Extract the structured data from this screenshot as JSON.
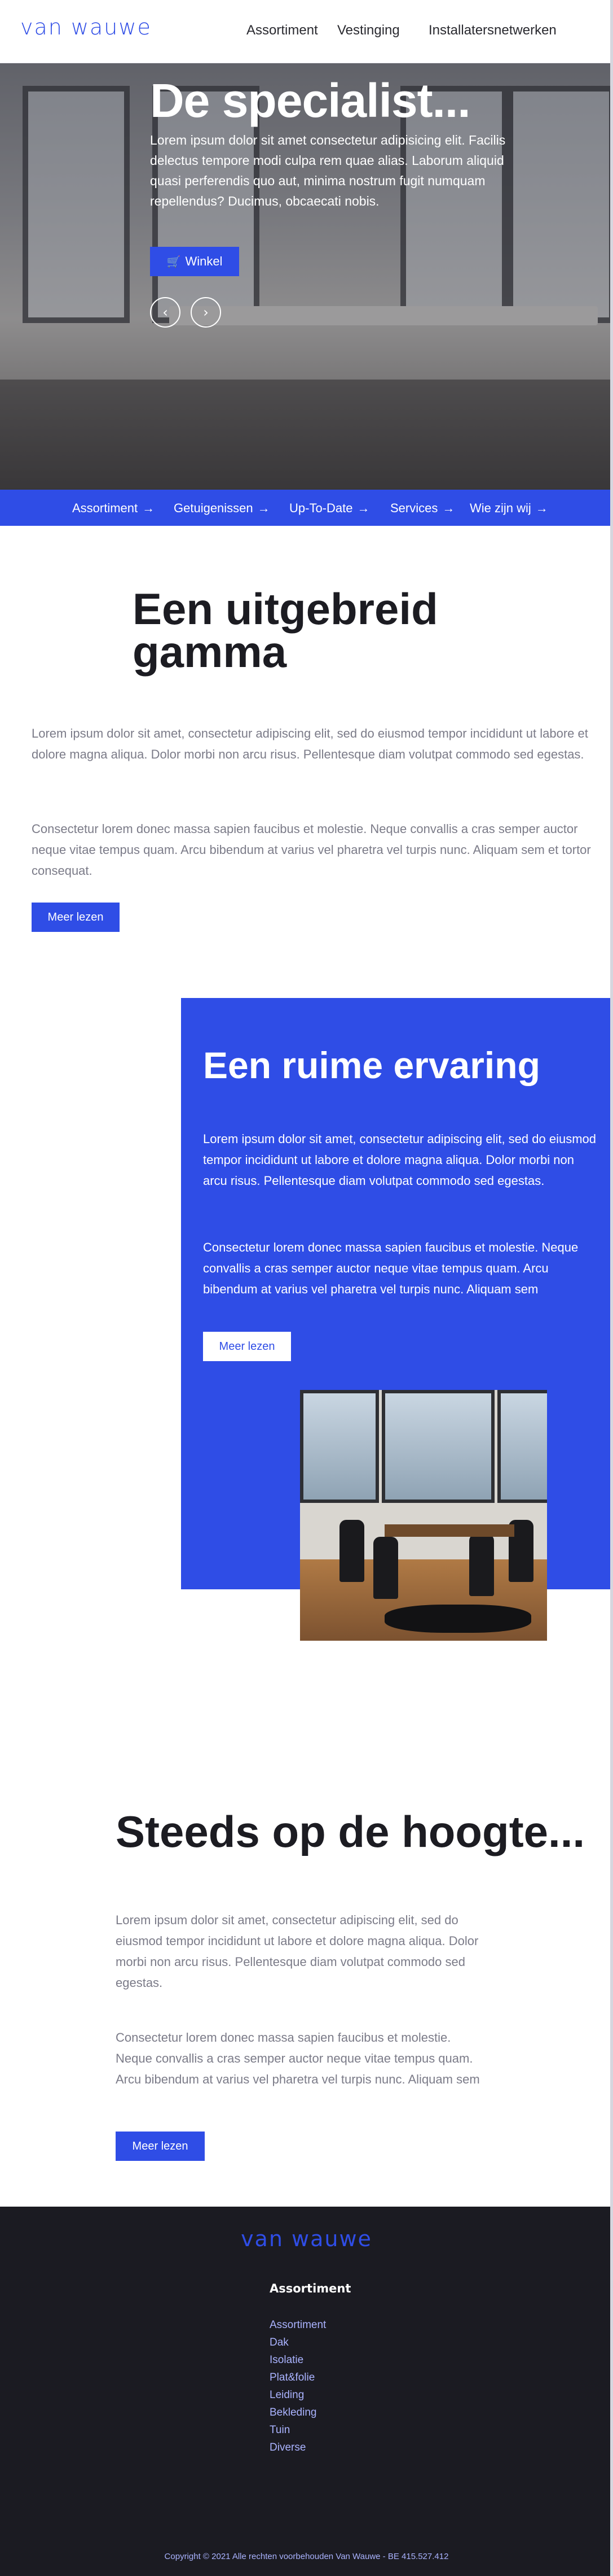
{
  "header": {
    "logo": "van wauwe",
    "nav": [
      "Assortiment",
      "Vestinging",
      "Installatersnetwerken"
    ]
  },
  "hero": {
    "title": "De specialist...",
    "text": "Lorem ipsum dolor sit amet consectetur adipisicing elit. Facilis delectus tempore modi culpa rem quae alias. Laborum aliquid quasi perferendis quo aut, minima nostrum fugit numquam repellendus? Ducimus, obcaecati nobis.",
    "button": "Winkel",
    "prev_icon": "‹",
    "next_icon": "›"
  },
  "linkbar": {
    "items": [
      "Assortiment",
      "Getuigenissen",
      "Up-To-Date",
      "Services",
      "Wie zijn wij"
    ],
    "arrow": "→"
  },
  "section1": {
    "title": "Een uitgebreid gamma",
    "p1": "Lorem ipsum dolor sit amet, consectetur adipiscing elit, sed do eiusmod tempor incididunt ut labore et dolore magna aliqua. Dolor morbi non arcu risus. Pellentesque diam volutpat commodo sed egestas.",
    "p2": "Consectetur lorem donec massa sapien faucibus et molestie. Neque convallis a cras semper auctor neque vitae tempus quam. Arcu bibendum at varius vel pharetra vel turpis nunc. Aliquam sem et tortor consequat.",
    "button": "Meer lezen"
  },
  "section2": {
    "title": "Een ruime ervaring",
    "p1": "Lorem ipsum dolor sit amet, consectetur adipiscing elit, sed do eiusmod tempor incididunt ut labore et dolore magna aliqua. Dolor morbi non arcu risus. Pellentesque diam volutpat commodo sed egestas.",
    "p2": "Consectetur lorem donec massa sapien faucibus et molestie. Neque convallis a cras semper auctor neque vitae tempus quam. Arcu bibendum at varius vel pharetra vel turpis nunc. Aliquam sem",
    "button": "Meer lezen"
  },
  "section3": {
    "title": "Steeds op de hoogte...",
    "p1": "Lorem ipsum dolor sit amet, consectetur adipiscing elit, sed do eiusmod tempor incididunt ut labore et dolore magna aliqua. Dolor morbi non arcu risus. Pellentesque diam volutpat commodo sed egestas.",
    "p2": "Consectetur lorem donec massa sapien faucibus et molestie. Neque convallis a cras semper auctor neque vitae tempus quam. Arcu bibendum at varius vel pharetra vel turpis nunc. Aliquam sem",
    "button": "Meer lezen"
  },
  "footer": {
    "logo": "van wauwe",
    "heading": "Assortiment",
    "links": [
      "Assortiment",
      "Dak",
      "Isolatie",
      "Plat&folie",
      "Leiding",
      "Bekleding",
      "Tuin",
      "Diverse"
    ],
    "copyright": "Copyright © 2021 Alle rechten voorbehouden Van Wauwe - BE 415.527.412"
  },
  "colors": {
    "accent": "#2f4de6",
    "footer_bg": "#1b1b22",
    "text_dark": "#1c1c22",
    "text_muted": "#7b7b88"
  }
}
